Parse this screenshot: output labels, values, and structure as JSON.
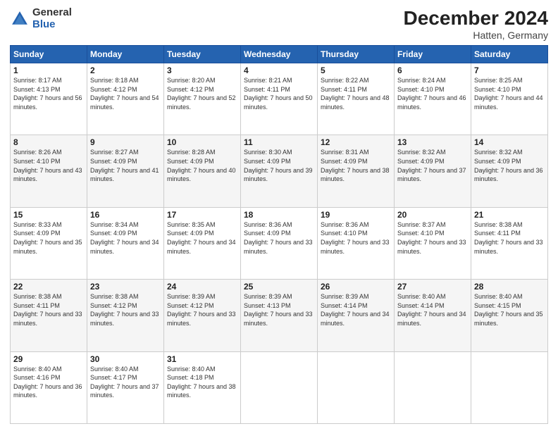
{
  "logo": {
    "general": "General",
    "blue": "Blue"
  },
  "title": "December 2024",
  "location": "Hatten, Germany",
  "days_header": [
    "Sunday",
    "Monday",
    "Tuesday",
    "Wednesday",
    "Thursday",
    "Friday",
    "Saturday"
  ],
  "weeks": [
    [
      {
        "day": "1",
        "sunrise": "8:17 AM",
        "sunset": "4:13 PM",
        "daylight": "7 hours and 56 minutes."
      },
      {
        "day": "2",
        "sunrise": "8:18 AM",
        "sunset": "4:12 PM",
        "daylight": "7 hours and 54 minutes."
      },
      {
        "day": "3",
        "sunrise": "8:20 AM",
        "sunset": "4:12 PM",
        "daylight": "7 hours and 52 minutes."
      },
      {
        "day": "4",
        "sunrise": "8:21 AM",
        "sunset": "4:11 PM",
        "daylight": "7 hours and 50 minutes."
      },
      {
        "day": "5",
        "sunrise": "8:22 AM",
        "sunset": "4:11 PM",
        "daylight": "7 hours and 48 minutes."
      },
      {
        "day": "6",
        "sunrise": "8:24 AM",
        "sunset": "4:10 PM",
        "daylight": "7 hours and 46 minutes."
      },
      {
        "day": "7",
        "sunrise": "8:25 AM",
        "sunset": "4:10 PM",
        "daylight": "7 hours and 44 minutes."
      }
    ],
    [
      {
        "day": "8",
        "sunrise": "8:26 AM",
        "sunset": "4:10 PM",
        "daylight": "7 hours and 43 minutes."
      },
      {
        "day": "9",
        "sunrise": "8:27 AM",
        "sunset": "4:09 PM",
        "daylight": "7 hours and 41 minutes."
      },
      {
        "day": "10",
        "sunrise": "8:28 AM",
        "sunset": "4:09 PM",
        "daylight": "7 hours and 40 minutes."
      },
      {
        "day": "11",
        "sunrise": "8:30 AM",
        "sunset": "4:09 PM",
        "daylight": "7 hours and 39 minutes."
      },
      {
        "day": "12",
        "sunrise": "8:31 AM",
        "sunset": "4:09 PM",
        "daylight": "7 hours and 38 minutes."
      },
      {
        "day": "13",
        "sunrise": "8:32 AM",
        "sunset": "4:09 PM",
        "daylight": "7 hours and 37 minutes."
      },
      {
        "day": "14",
        "sunrise": "8:32 AM",
        "sunset": "4:09 PM",
        "daylight": "7 hours and 36 minutes."
      }
    ],
    [
      {
        "day": "15",
        "sunrise": "8:33 AM",
        "sunset": "4:09 PM",
        "daylight": "7 hours and 35 minutes."
      },
      {
        "day": "16",
        "sunrise": "8:34 AM",
        "sunset": "4:09 PM",
        "daylight": "7 hours and 34 minutes."
      },
      {
        "day": "17",
        "sunrise": "8:35 AM",
        "sunset": "4:09 PM",
        "daylight": "7 hours and 34 minutes."
      },
      {
        "day": "18",
        "sunrise": "8:36 AM",
        "sunset": "4:09 PM",
        "daylight": "7 hours and 33 minutes."
      },
      {
        "day": "19",
        "sunrise": "8:36 AM",
        "sunset": "4:10 PM",
        "daylight": "7 hours and 33 minutes."
      },
      {
        "day": "20",
        "sunrise": "8:37 AM",
        "sunset": "4:10 PM",
        "daylight": "7 hours and 33 minutes."
      },
      {
        "day": "21",
        "sunrise": "8:38 AM",
        "sunset": "4:11 PM",
        "daylight": "7 hours and 33 minutes."
      }
    ],
    [
      {
        "day": "22",
        "sunrise": "8:38 AM",
        "sunset": "4:11 PM",
        "daylight": "7 hours and 33 minutes."
      },
      {
        "day": "23",
        "sunrise": "8:38 AM",
        "sunset": "4:12 PM",
        "daylight": "7 hours and 33 minutes."
      },
      {
        "day": "24",
        "sunrise": "8:39 AM",
        "sunset": "4:12 PM",
        "daylight": "7 hours and 33 minutes."
      },
      {
        "day": "25",
        "sunrise": "8:39 AM",
        "sunset": "4:13 PM",
        "daylight": "7 hours and 33 minutes."
      },
      {
        "day": "26",
        "sunrise": "8:39 AM",
        "sunset": "4:14 PM",
        "daylight": "7 hours and 34 minutes."
      },
      {
        "day": "27",
        "sunrise": "8:40 AM",
        "sunset": "4:14 PM",
        "daylight": "7 hours and 34 minutes."
      },
      {
        "day": "28",
        "sunrise": "8:40 AM",
        "sunset": "4:15 PM",
        "daylight": "7 hours and 35 minutes."
      }
    ],
    [
      {
        "day": "29",
        "sunrise": "8:40 AM",
        "sunset": "4:16 PM",
        "daylight": "7 hours and 36 minutes."
      },
      {
        "day": "30",
        "sunrise": "8:40 AM",
        "sunset": "4:17 PM",
        "daylight": "7 hours and 37 minutes."
      },
      {
        "day": "31",
        "sunrise": "8:40 AM",
        "sunset": "4:18 PM",
        "daylight": "7 hours and 38 minutes."
      },
      null,
      null,
      null,
      null
    ]
  ],
  "labels": {
    "sunrise": "Sunrise:",
    "sunset": "Sunset:",
    "daylight": "Daylight:"
  }
}
